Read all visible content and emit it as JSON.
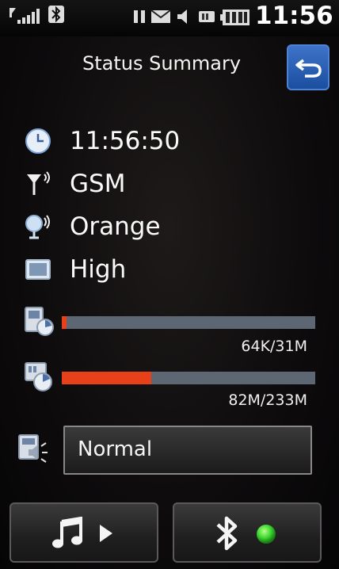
{
  "status_bar": {
    "time": "11:56",
    "icons": [
      "signal-icon",
      "bluetooth-icon",
      "pause-icon",
      "mail-icon",
      "speaker-icon",
      "memory-card-icon",
      "battery-icon"
    ]
  },
  "header": {
    "title": "Status Summary",
    "back_icon": "return-arrow-icon"
  },
  "rows": {
    "time": {
      "icon": "clock-icon",
      "value": "11:56:50"
    },
    "network": {
      "icon": "antenna-icon",
      "value": "GSM"
    },
    "operator": {
      "icon": "globe-signal-icon",
      "value": "Orange"
    },
    "brightness": {
      "icon": "screen-icon",
      "value": "High"
    }
  },
  "storage": {
    "phone_memory": {
      "icon": "phone-memory-icon",
      "label": "64K/31M",
      "fill_fraction": 0.006
    },
    "card_memory": {
      "icon": "card-memory-icon",
      "label": "82M/233M",
      "fill_fraction": 0.352
    }
  },
  "profile": {
    "icon": "profile-speaker-icon",
    "value": "Normal"
  },
  "bottom_buttons": {
    "music": {
      "icons": [
        "music-note-icon",
        "play-icon"
      ]
    },
    "bluetooth": {
      "icons": [
        "bluetooth-icon",
        "status-dot-icon"
      ],
      "status_color": "#3bd62e"
    }
  },
  "colors": {
    "accent_blue": "#2a5fb4",
    "bar_fill": "#e8411a",
    "bar_track": "#5d6774"
  }
}
